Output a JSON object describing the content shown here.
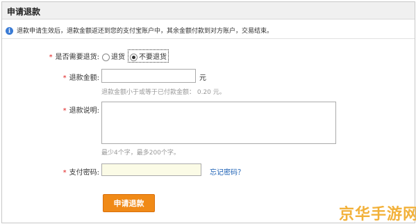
{
  "header": {
    "title": "申请退款"
  },
  "notice": {
    "text": "退款申请生效后，退款金额返还到您的支付宝账户中，其余金额付款到对方账户，交易结束。"
  },
  "form": {
    "required_mark": "*",
    "return_goods": {
      "label": "是否需要退货:",
      "options": [
        "退货",
        "不要退货"
      ],
      "selected": "不要退货"
    },
    "amount": {
      "label": "退款金额:",
      "value": "",
      "unit": "元",
      "hint": "退款金额小于或等于已付款金额： 0.20 元。"
    },
    "explanation": {
      "label": "退款说明:",
      "value": "",
      "hint": "最少4个字，最多200个字。"
    },
    "password": {
      "label": "支付密码:",
      "value": "",
      "forgot_link": "忘记密码？"
    },
    "submit_label": "申请退款"
  },
  "watermark": "京华手游网",
  "colors": {
    "button": "#f08a17",
    "required": "#e02020",
    "link": "#1a5fb4",
    "watermark": "#f2b13a"
  }
}
